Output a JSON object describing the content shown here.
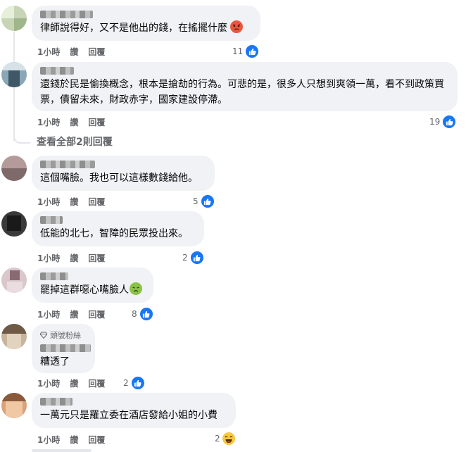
{
  "comments": [
    {
      "text": "律師說得好，又不是他出的錢，在搖擺什麼",
      "emoji": "angry",
      "time": "1小時",
      "like_label": "讚",
      "reply_label": "回覆",
      "reactions": "11",
      "reaction_type": "like"
    },
    {
      "text": "還錢於民是偷換概念，根本是搶劫的行為。可悲的是，很多人只想到爽領一萬，看不到政策買票，債留未來，財政赤字，國家建設停滯。",
      "time": "1小時",
      "like_label": "讚",
      "reply_label": "回覆",
      "reactions": "19",
      "reaction_type": "like"
    },
    {
      "text": "這個嘴臉。我也可以這樣數錢給他。",
      "time": "1小時",
      "like_label": "讚",
      "reply_label": "回覆",
      "reactions": "5",
      "reaction_type": "like"
    },
    {
      "text": "低能的北七，智障的民眾投出來。",
      "time": "1小時",
      "like_label": "讚",
      "reply_label": "回覆",
      "reactions": "2",
      "reaction_type": "like"
    },
    {
      "text": "罷掉這群噁心嘴臉人",
      "emoji": "nauseated",
      "time": "1小時",
      "like_label": "讚",
      "reply_label": "回覆",
      "reactions": "8",
      "reaction_type": "like"
    },
    {
      "badge": "頭號粉絲",
      "text": "糟透了",
      "time": "1小時",
      "like_label": "讚",
      "reply_label": "回覆",
      "reactions": "2",
      "reaction_type": "like"
    },
    {
      "text": "一萬元只是羅立委在酒店發給小姐的小費",
      "time": "1小時",
      "like_label": "讚",
      "reply_label": "回覆",
      "reactions": "2",
      "reaction_type": "haha"
    }
  ],
  "see_all_replies": "查看全部2則回覆",
  "icons": {
    "like": "thumbs-up-icon",
    "haha": "laughing-emoji-icon",
    "angry": "angry-emoji-icon",
    "nauseated": "nauseated-emoji-icon",
    "badge": "diamond-icon"
  },
  "colors": {
    "bubble": "#f0f2f5",
    "like_blue": "#1877f2",
    "meta_gray": "#65676b"
  }
}
